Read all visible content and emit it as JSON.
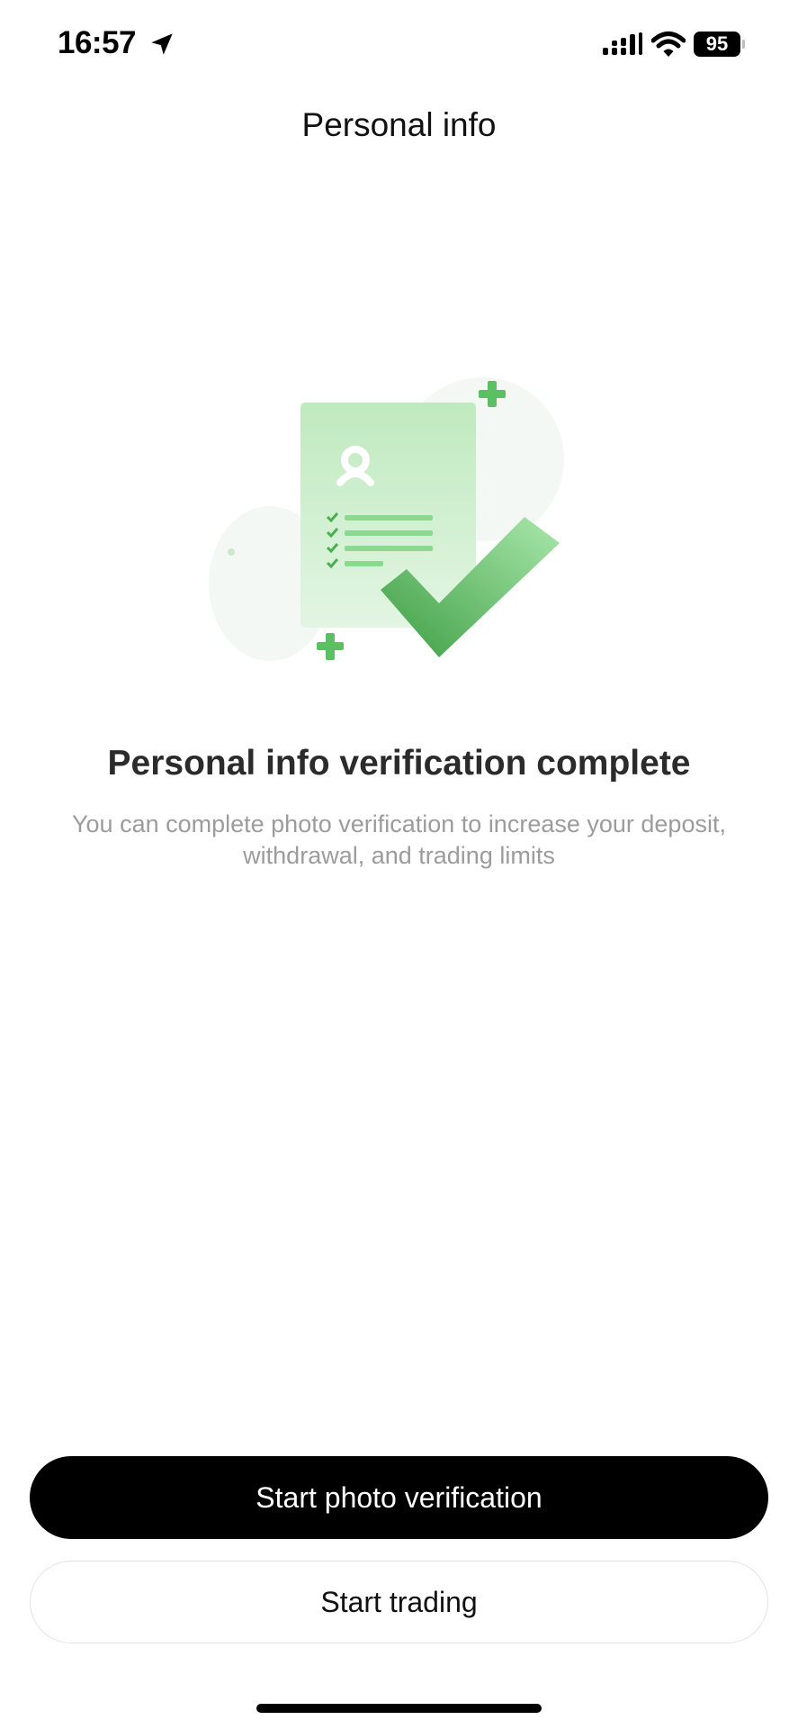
{
  "status_bar": {
    "time": "16:57",
    "battery_level": "95",
    "icons": [
      "location-arrow-icon",
      "signal-icon",
      "wifi-icon",
      "battery-icon"
    ]
  },
  "header": {
    "title": "Personal info"
  },
  "illustration": {
    "icon": "document-checkmark-icon",
    "accent_color": "#4caf50",
    "light_color": "#c8ecc8"
  },
  "main": {
    "headline": "Personal info verification complete",
    "description": "You can complete photo verification to increase your deposit, withdrawal, and trading limits"
  },
  "actions": {
    "primary_label": "Start photo verification",
    "secondary_label": "Start trading"
  }
}
